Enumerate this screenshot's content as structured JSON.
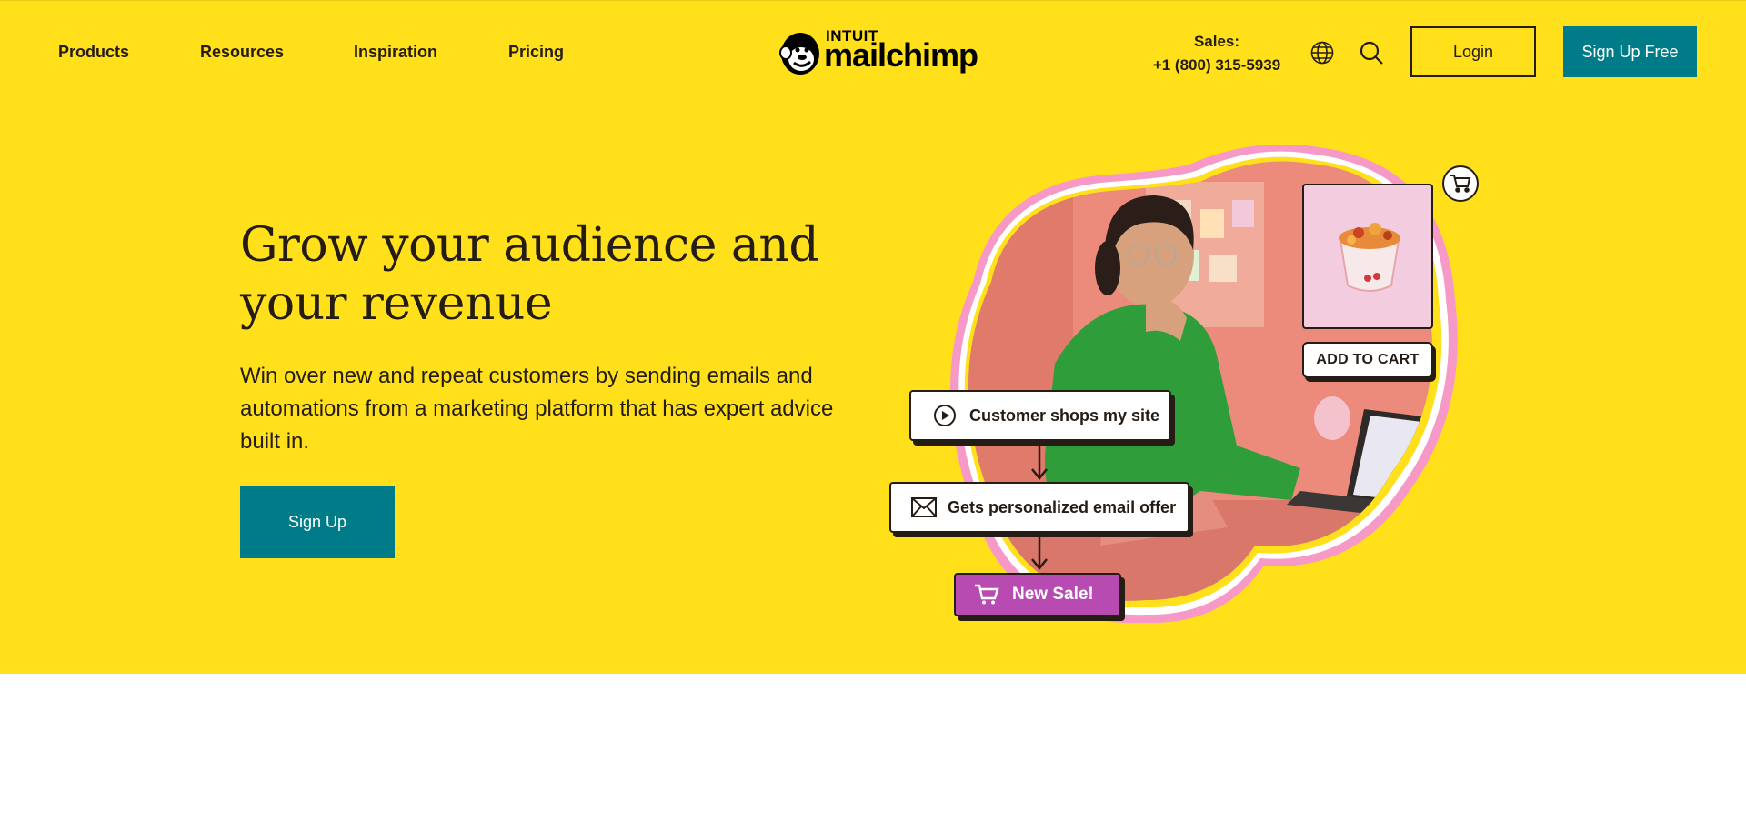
{
  "nav": {
    "links": [
      "Products",
      "Resources",
      "Inspiration",
      "Pricing"
    ],
    "logo_small": "INTUIT",
    "logo_word": "mailchimp",
    "sales_label": "Sales:",
    "sales_phone": "+1 (800) 315-5939",
    "globe_icon": "globe-icon",
    "search_icon": "search-icon",
    "login": "Login",
    "signup_free": "Sign Up Free"
  },
  "hero": {
    "headline": "Grow your audience and your revenue",
    "subtext": "Win over new and repeat customers by sending emails and automations from a marketing platform that has expert advice built in.",
    "cta": "Sign Up"
  },
  "illustration": {
    "step1": "Customer shops my site",
    "step2": "Gets personalized email offer",
    "step3": "New Sale!",
    "add_to_cart": "ADD TO CART"
  },
  "colors": {
    "brand_yellow": "#ffe01b",
    "teal": "#007c89",
    "ink": "#241c15",
    "sale_purple": "#b84bb1",
    "pink_ring": "#f799c6"
  }
}
